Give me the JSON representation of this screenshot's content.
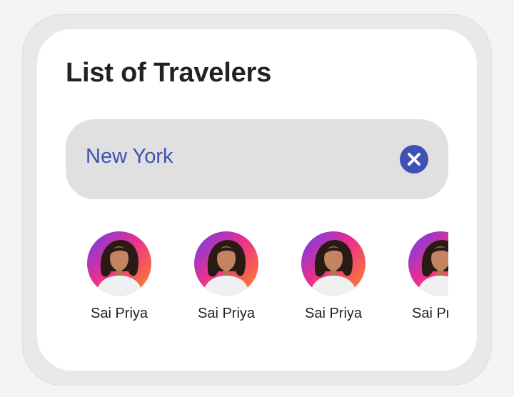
{
  "page": {
    "title": "List of Travelers"
  },
  "search": {
    "value": "New York",
    "clear_icon": "close-circle-icon",
    "accent_color": "#3f51b5"
  },
  "travelers": [
    {
      "name": "Sai Priya",
      "avatar_icon": "traveler-photo"
    },
    {
      "name": "Sai Priya",
      "avatar_icon": "traveler-photo"
    },
    {
      "name": "Sai Priya",
      "avatar_icon": "traveler-photo"
    },
    {
      "name": "Sai Priya",
      "avatar_icon": "traveler-photo"
    }
  ]
}
